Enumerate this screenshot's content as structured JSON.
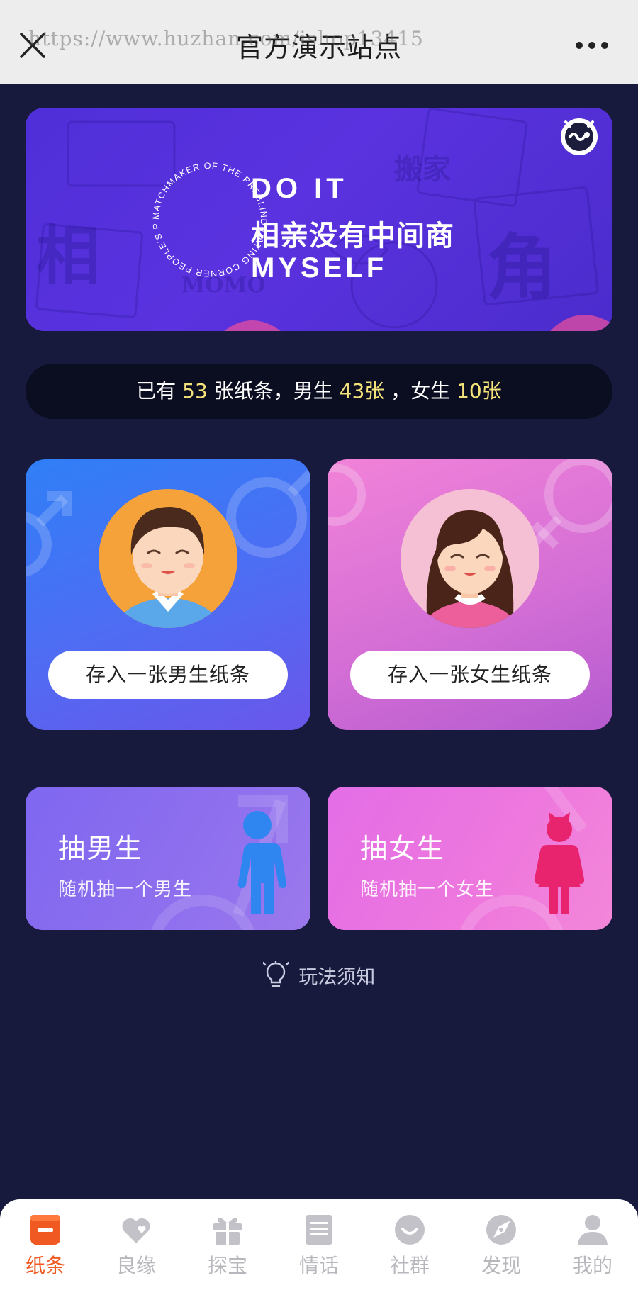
{
  "topbar": {
    "title": "官方演示站点",
    "watermark": "https://www.huzhan.com/ishop13415"
  },
  "banner": {
    "line1": "DO IT",
    "line2": "相亲没有中间商",
    "line3": "MYSELF",
    "ring_text": "MATCHMAKER OF THE PREBLIND DATING CORNER PEOPLE'S PARK DESTINED",
    "bg_chars": [
      "相",
      "角",
      "搬家",
      "MOMO"
    ]
  },
  "stats": {
    "prefix": "已有",
    "total": "53",
    "mid1": "张纸条，男生",
    "male": "43张",
    "mid2": "，女生",
    "female": "10张"
  },
  "cards": {
    "male_button": "存入一张男生纸条",
    "female_button": "存入一张女生纸条"
  },
  "draw": {
    "male_title": "抽男生",
    "male_sub": "随机抽一个男生",
    "female_title": "抽女生",
    "female_sub": "随机抽一个女生"
  },
  "rules": {
    "label": "玩法须知"
  },
  "tabs": [
    {
      "label": "纸条",
      "icon": "note-icon",
      "active": true
    },
    {
      "label": "良缘",
      "icon": "heart-icon"
    },
    {
      "label": "探宝",
      "icon": "gift-icon"
    },
    {
      "label": "情话",
      "icon": "book-icon"
    },
    {
      "label": "社群",
      "icon": "smile-icon"
    },
    {
      "label": "发现",
      "icon": "discover-icon"
    },
    {
      "label": "我的",
      "icon": "user-icon"
    }
  ],
  "colors": {
    "background": "#171a3c",
    "accent": "#f05a22",
    "highlight": "#f3e27a",
    "tab_inactive": "#b7b7bd"
  }
}
